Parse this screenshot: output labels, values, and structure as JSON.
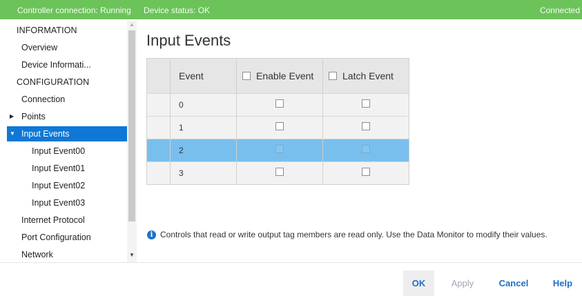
{
  "status_bar": {
    "controller": "Controller connection: Running",
    "device": "Device status: OK",
    "connection": "Connected",
    "color": "#6cc35a"
  },
  "sidebar": {
    "items": [
      {
        "label": "INFORMATION",
        "kind": "section"
      },
      {
        "label": "Overview",
        "kind": "item"
      },
      {
        "label": "Device Informati...",
        "kind": "item"
      },
      {
        "label": "CONFIGURATION",
        "kind": "section"
      },
      {
        "label": "Connection",
        "kind": "item"
      },
      {
        "label": "Points",
        "kind": "collapsed",
        "icon": "triangle-right-icon"
      },
      {
        "label": "Input Events",
        "kind": "expanded-selected",
        "icon": "triangle-down-icon"
      },
      {
        "label": "Input Event00",
        "kind": "child"
      },
      {
        "label": "Input Event01",
        "kind": "child"
      },
      {
        "label": "Input Event02",
        "kind": "child"
      },
      {
        "label": "Input Event03",
        "kind": "child"
      },
      {
        "label": "Internet Protocol",
        "kind": "item"
      },
      {
        "label": "Port Configuration",
        "kind": "item"
      },
      {
        "label": "Network",
        "kind": "item"
      }
    ],
    "selected_color": "#0f78d7"
  },
  "main": {
    "title": "Input Events",
    "table": {
      "columns": {
        "event": "Event",
        "enable": "Enable Event",
        "latch": "Latch Event"
      },
      "rows": [
        {
          "event": "0",
          "enable": false,
          "latch": false
        },
        {
          "event": "1",
          "enable": false,
          "latch": false
        },
        {
          "event": "2",
          "enable": false,
          "latch": false,
          "selected": true
        },
        {
          "event": "3",
          "enable": false,
          "latch": false
        }
      ],
      "selected_row_color": "#78bfee"
    },
    "info_text": "Controls that read or write output tag members are read only. Use the Data Monitor to modify their values.",
    "info_icon": "info-icon"
  },
  "footer": {
    "ok": "OK",
    "apply": "Apply",
    "cancel": "Cancel",
    "help": "Help"
  }
}
